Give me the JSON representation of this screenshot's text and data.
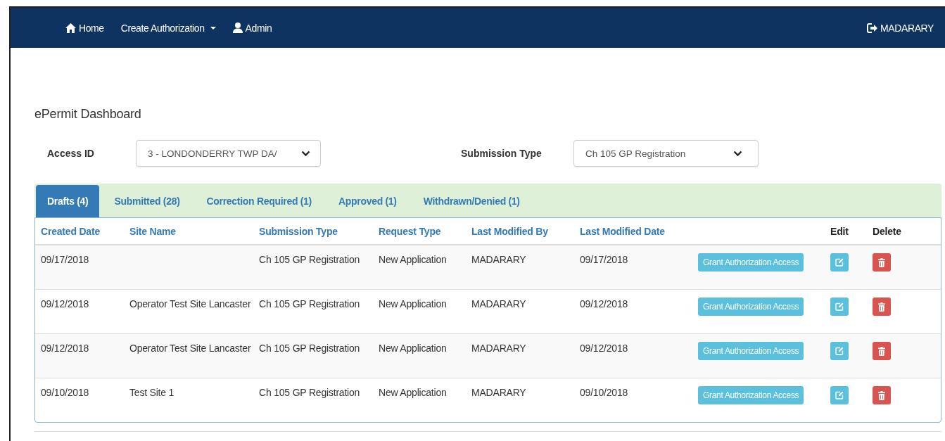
{
  "navbar": {
    "items": [
      {
        "label": "Home",
        "kind": "home"
      },
      {
        "label": "Create Authorization",
        "kind": "dropdown"
      },
      {
        "label": "Admin",
        "kind": "user"
      }
    ],
    "user": "MADARARY"
  },
  "page_title": "ePermit Dashboard",
  "filters": [
    {
      "label": "Access ID",
      "value": "3 - LONDONDERRY TWP DA/"
    },
    {
      "label": "Submission Type",
      "value": "Ch 105 GP Registration"
    }
  ],
  "tabs": [
    {
      "label": "Drafts (4)",
      "selected": true
    },
    {
      "label": "Submitted (28)",
      "selected": false
    },
    {
      "label": "Correction Required (1)",
      "selected": false
    },
    {
      "label": "Approved (1)",
      "selected": false
    },
    {
      "label": "Withdrawn/Denied (1)",
      "selected": false
    }
  ],
  "table": {
    "columns": [
      {
        "label": "Created Date",
        "kind": "link"
      },
      {
        "label": "Site Name",
        "kind": "link"
      },
      {
        "label": "Submission Type",
        "kind": "link"
      },
      {
        "label": "Request Type",
        "kind": "link"
      },
      {
        "label": "Last Modified By",
        "kind": "link"
      },
      {
        "label": "Last Modified Date",
        "kind": "link"
      },
      {
        "label": "Edit",
        "kind": "plain"
      },
      {
        "label": "Delete",
        "kind": "plain"
      }
    ],
    "rows": [
      {
        "created_date": "09/17/2018",
        "submission_type": "Ch 105 GP Registration",
        "request_type": "New Application",
        "last_modified_by": "MADARARY",
        "last_modified_date": "09/17/2018",
        "action": "Grant Authorization Access"
      },
      {
        "created_date": "09/12/2018",
        "site_name": "Operator Test Site Lancaster",
        "submission_type": "Ch 105 GP Registration",
        "request_type": "New Application",
        "last_modified_by": "MADARARY",
        "last_modified_date": "09/12/2018",
        "action": "Grant Authorization Access"
      },
      {
        "created_date": "09/12/2018",
        "site_name": "Operator Test Site Lancaster",
        "submission_type": "Ch 105 GP Registration",
        "request_type": "New Application",
        "last_modified_by": "MADARARY",
        "last_modified_date": "09/12/2018",
        "action": "Grant Authorization Access"
      },
      {
        "created_date": "09/10/2018",
        "site_name": "Test Site 1",
        "submission_type": "Ch 105 GP Registration",
        "request_type": "New Application",
        "last_modified_by": "MADARARY",
        "last_modified_date": "09/10/2018",
        "action": "Grant Authorization Access"
      }
    ]
  }
}
